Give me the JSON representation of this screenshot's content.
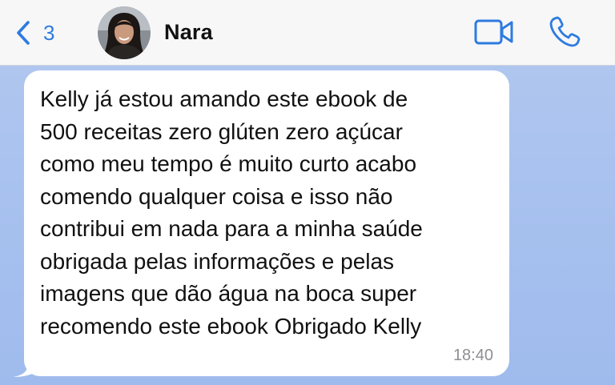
{
  "header": {
    "back_count": "3",
    "contact_name": "Nara",
    "icons": {
      "back": "chevron-left-icon",
      "video": "video-camera-icon",
      "call": "phone-icon"
    },
    "accent_color": "#2e7be0"
  },
  "message": {
    "text": "Kelly já estou amando este ebook de\n500 receitas zero glúten zero açúcar\ncomo meu tempo é muito curto acabo\ncomendo qualquer coisa e isso não\ncontribui em nada para a minha saúde\nobrigada pelas informações e pelas\nimagens que dão água na boca super\nrecomendo este ebook Obrigado Kelly",
    "time": "18:40"
  },
  "colors": {
    "header_bg": "#f7f7f8",
    "chat_bg": "#a9c2ef",
    "bubble_bg": "#ffffff",
    "time_text": "#8e8e93"
  }
}
